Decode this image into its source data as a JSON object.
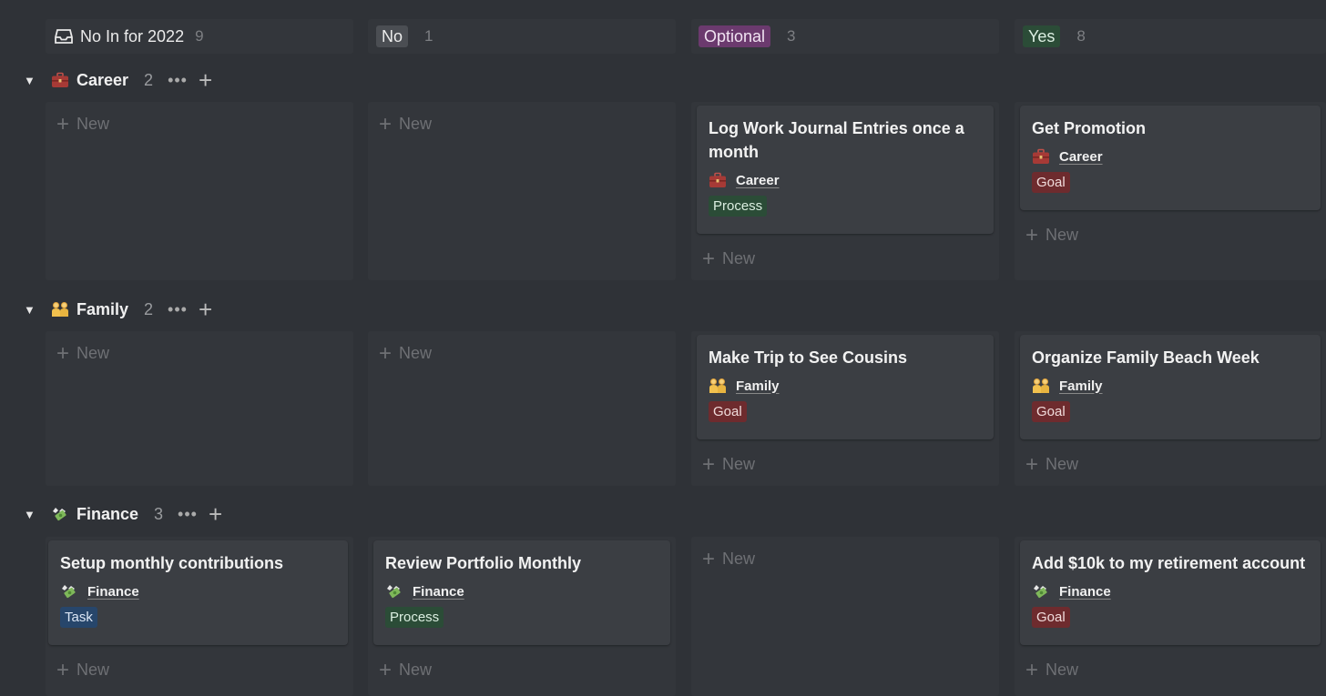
{
  "columns": [
    {
      "label": "No In for 2022",
      "count": "9"
    },
    {
      "label": "No",
      "count": "1"
    },
    {
      "label": "Optional",
      "count": "3"
    },
    {
      "label": "Yes",
      "count": "8"
    }
  ],
  "colors": {
    "no_pill": "#4b4e53",
    "optional_pill": "#6b3a6e",
    "yes_pill": "#2b4c37",
    "goal_tag": "#6e2b2e",
    "process_tag": "#2b4c37",
    "task_tag": "#27466b"
  },
  "new_label": "New",
  "groups": [
    {
      "name": "Career",
      "count": "2",
      "icon": "briefcase-icon",
      "cards": {
        "optional": {
          "title": "Log Work Journal Entries once a month",
          "relation": "Career",
          "tag": "Process"
        },
        "yes": {
          "title": "Get Promotion",
          "relation": "Career",
          "tag": "Goal"
        }
      }
    },
    {
      "name": "Family",
      "count": "2",
      "icon": "family-icon",
      "cards": {
        "optional": {
          "title": "Make Trip to See Cousins",
          "relation": "Family",
          "tag": "Goal"
        },
        "yes": {
          "title": "Organize Family Beach Week",
          "relation": "Family",
          "tag": "Goal"
        }
      }
    },
    {
      "name": "Finance",
      "count": "3",
      "icon": "money-wings-icon",
      "cards": {
        "no_in": {
          "title": "Setup monthly contributions",
          "relation": "Finance",
          "tag": "Task"
        },
        "no": {
          "title": "Review Portfolio Monthly",
          "relation": "Finance",
          "tag": "Process"
        },
        "yes": {
          "title": "Add $10k to my retirement account",
          "relation": "Finance",
          "tag": "Goal"
        }
      }
    }
  ]
}
